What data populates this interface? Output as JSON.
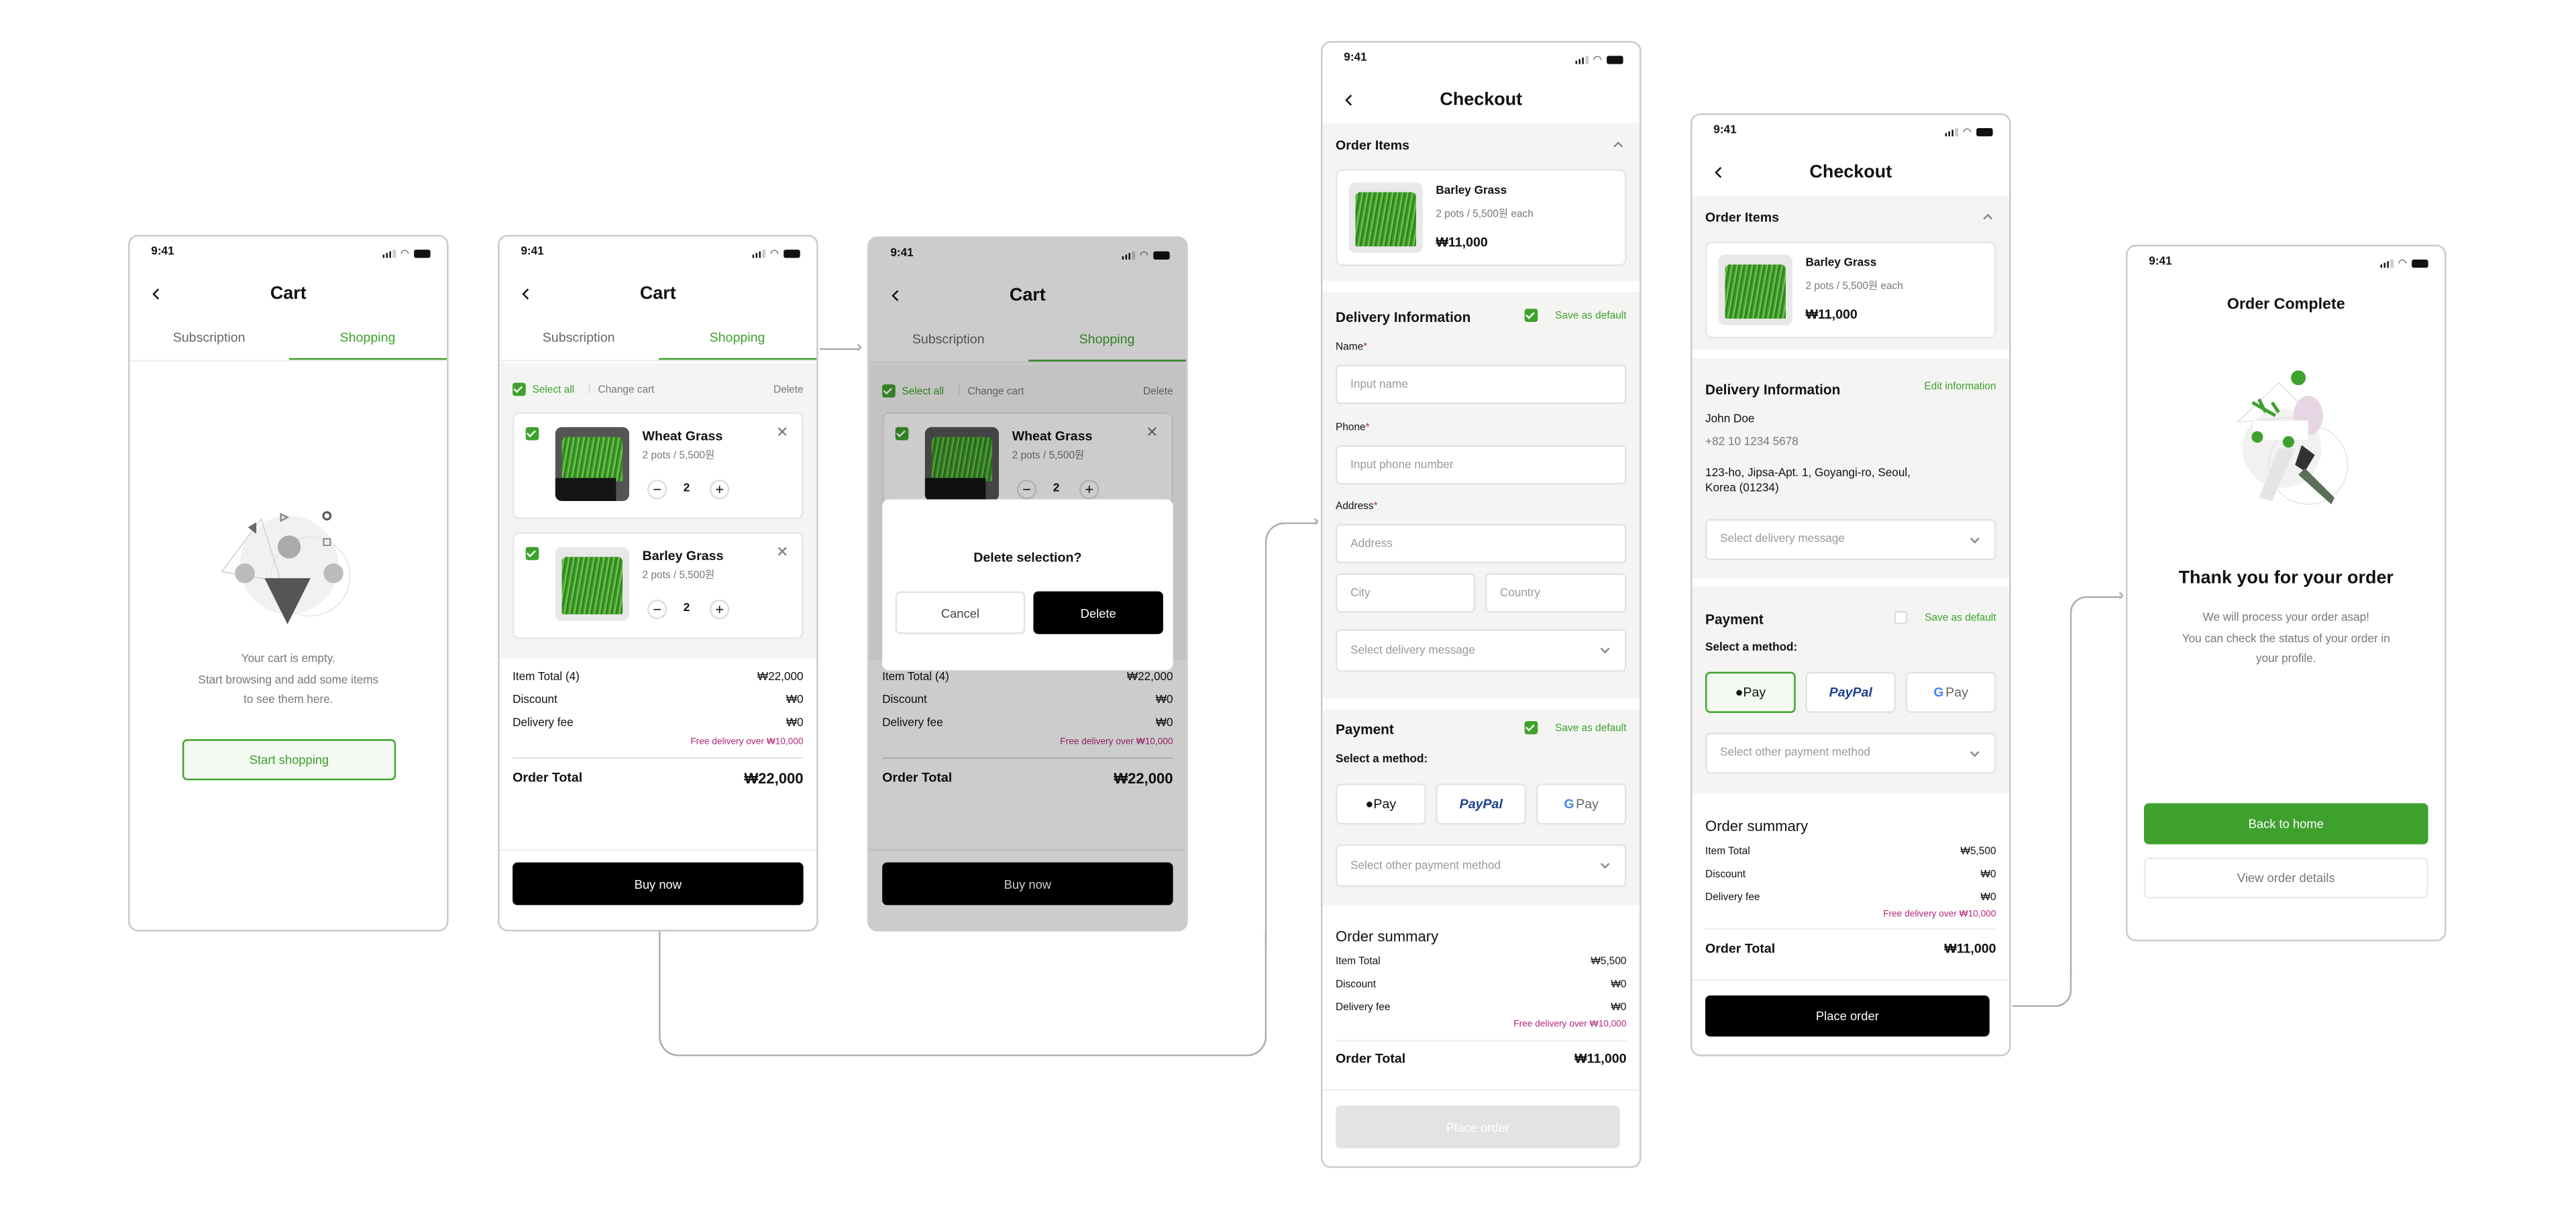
{
  "status_time": "9:41",
  "cart_empty": {
    "title": "Cart",
    "tabs": [
      "Subscription",
      "Shopping"
    ],
    "empty_lines": [
      "Your cart is empty.",
      "Start browsing and add some items",
      "to see them here."
    ],
    "start_shopping": "Start shopping"
  },
  "cart": {
    "title": "Cart",
    "tabs": [
      "Subscription",
      "Shopping"
    ],
    "select_all": "Select all",
    "divider": "|",
    "change_cart": "Change cart",
    "delete": "Delete",
    "items": [
      {
        "name": "Wheat Grass",
        "detail": "2 pots / 5,500원",
        "qty": "2",
        "checked": true
      },
      {
        "name": "Barley Grass",
        "detail": "2 pots / 5,500원",
        "qty": "2",
        "checked": true
      }
    ],
    "summary": {
      "item_total_label": "Item Total (4)",
      "item_total": "₩22,000",
      "discount_label": "Discount",
      "discount": "₩0",
      "delivery_label": "Delivery fee",
      "delivery": "₩0",
      "free_note": "Free delivery over ₩10,000",
      "order_total_label": "Order Total",
      "order_total": "₩22,000"
    },
    "buy_now": "Buy now",
    "minus": "−",
    "plus": "+"
  },
  "delete_dialog": {
    "title": "Delete selection?",
    "cancel": "Cancel",
    "confirm": "Delete"
  },
  "checkout_form": {
    "title": "Checkout",
    "order_items": "Order Items",
    "item": {
      "name": "Barley Grass",
      "detail": "2 pots / 5,500원 each",
      "price": "₩11,000"
    },
    "delivery_title": "Delivery Information",
    "save_default": "Save as default",
    "save_default_checked": true,
    "name_label": "Name",
    "name_placeholder": "Input name",
    "phone_label": "Phone",
    "phone_placeholder": "Input phone number",
    "address_label": "Address",
    "address_placeholder": "Address",
    "city_placeholder": "City",
    "country_placeholder": "Country",
    "required": "*",
    "delivery_message": "Select delivery message",
    "payment_title": "Payment",
    "payment_save_default": "Save as default",
    "payment_save_checked": true,
    "select_method": "Select a method:",
    "methods": [
      "Pay",
      "PayPal",
      "Pay"
    ],
    "other_method": "Select other payment method",
    "summary_title": "Order summary",
    "summary": {
      "item_total_label": "Item Total",
      "item_total": "₩5,500",
      "discount_label": "Discount",
      "discount": "₩0",
      "delivery_label": "Delivery fee",
      "delivery": "₩0",
      "free_note": "Free delivery over ₩10,000",
      "order_total_label": "Order Total",
      "order_total": "₩11,000"
    },
    "place_order": "Place order",
    "place_order_enabled": false
  },
  "checkout_filled": {
    "title": "Checkout",
    "order_items": "Order Items",
    "item": {
      "name": "Barley Grass",
      "detail": "2 pots / 5,500원 each",
      "price": "₩11,000"
    },
    "delivery_title": "Delivery Information",
    "edit": "Edit information",
    "customer": "John Doe",
    "phone": "+82 10 1234 5678",
    "address_lines": [
      "123-ho, Jipsa-Apt. 1, Goyangi-ro, Seoul,",
      "Korea (01234)"
    ],
    "delivery_message": "Select delivery message",
    "payment_title": "Payment",
    "save_default": "Save as default",
    "save_default_checked": false,
    "select_method": "Select a method:",
    "methods": [
      "Pay",
      "PayPal",
      "Pay"
    ],
    "selected_method": "Apple Pay",
    "other_method": "Select other payment method",
    "summary_title": "Order summary",
    "summary": {
      "item_total_label": "Item Total",
      "item_total": "₩5,500",
      "discount_label": "Discount",
      "discount": "₩0",
      "delivery_label": "Delivery fee",
      "delivery": "₩0",
      "free_note": "Free delivery over ₩10,000",
      "order_total_label": "Order Total",
      "order_total": "₩11,000"
    },
    "place_order": "Place order"
  },
  "order_complete": {
    "title": "Order Complete",
    "heading": "Thank you for your order",
    "lines": [
      "We will process your order asap!",
      "You can check the status of your order in",
      "your profile."
    ],
    "back_home": "Back to home",
    "view_details": "View order details"
  },
  "colors": {
    "accent": "#3ea12d",
    "note": "#b3277c",
    "section": "#f4f5f3",
    "paypal": "#1f3f8f"
  }
}
